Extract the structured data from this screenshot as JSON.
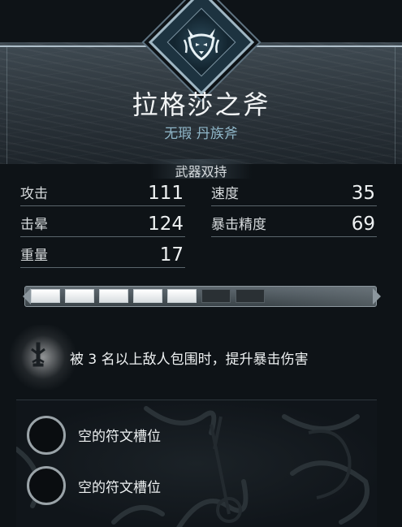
{
  "item": {
    "title": "拉格莎之斧",
    "subtitle": "无瑕 丹族斧",
    "category": "武器双持",
    "emblem_icon": "wolf-emblem-icon"
  },
  "stats": {
    "attack_label": "攻击",
    "attack_value": "111",
    "stun_label": "击晕",
    "stun_value": "124",
    "weight_label": "重量",
    "weight_value": "17",
    "speed_label": "速度",
    "speed_value": "35",
    "crit_label": "暴击精度",
    "crit_value": "69"
  },
  "upgrade_bar": {
    "filled_segments": 5,
    "total_segments": 7
  },
  "perk": {
    "icon": "rune-dagger-icon",
    "text": "被 3 名以上敌人包围时，提升暴击伤害"
  },
  "rune_slots": [
    {
      "label": "空的符文槽位"
    },
    {
      "label": "空的符文槽位"
    }
  ],
  "colors": {
    "accent_blue": "#8fb6c8",
    "segment_full": "#ffffff",
    "segment_empty": "#2a3034"
  }
}
